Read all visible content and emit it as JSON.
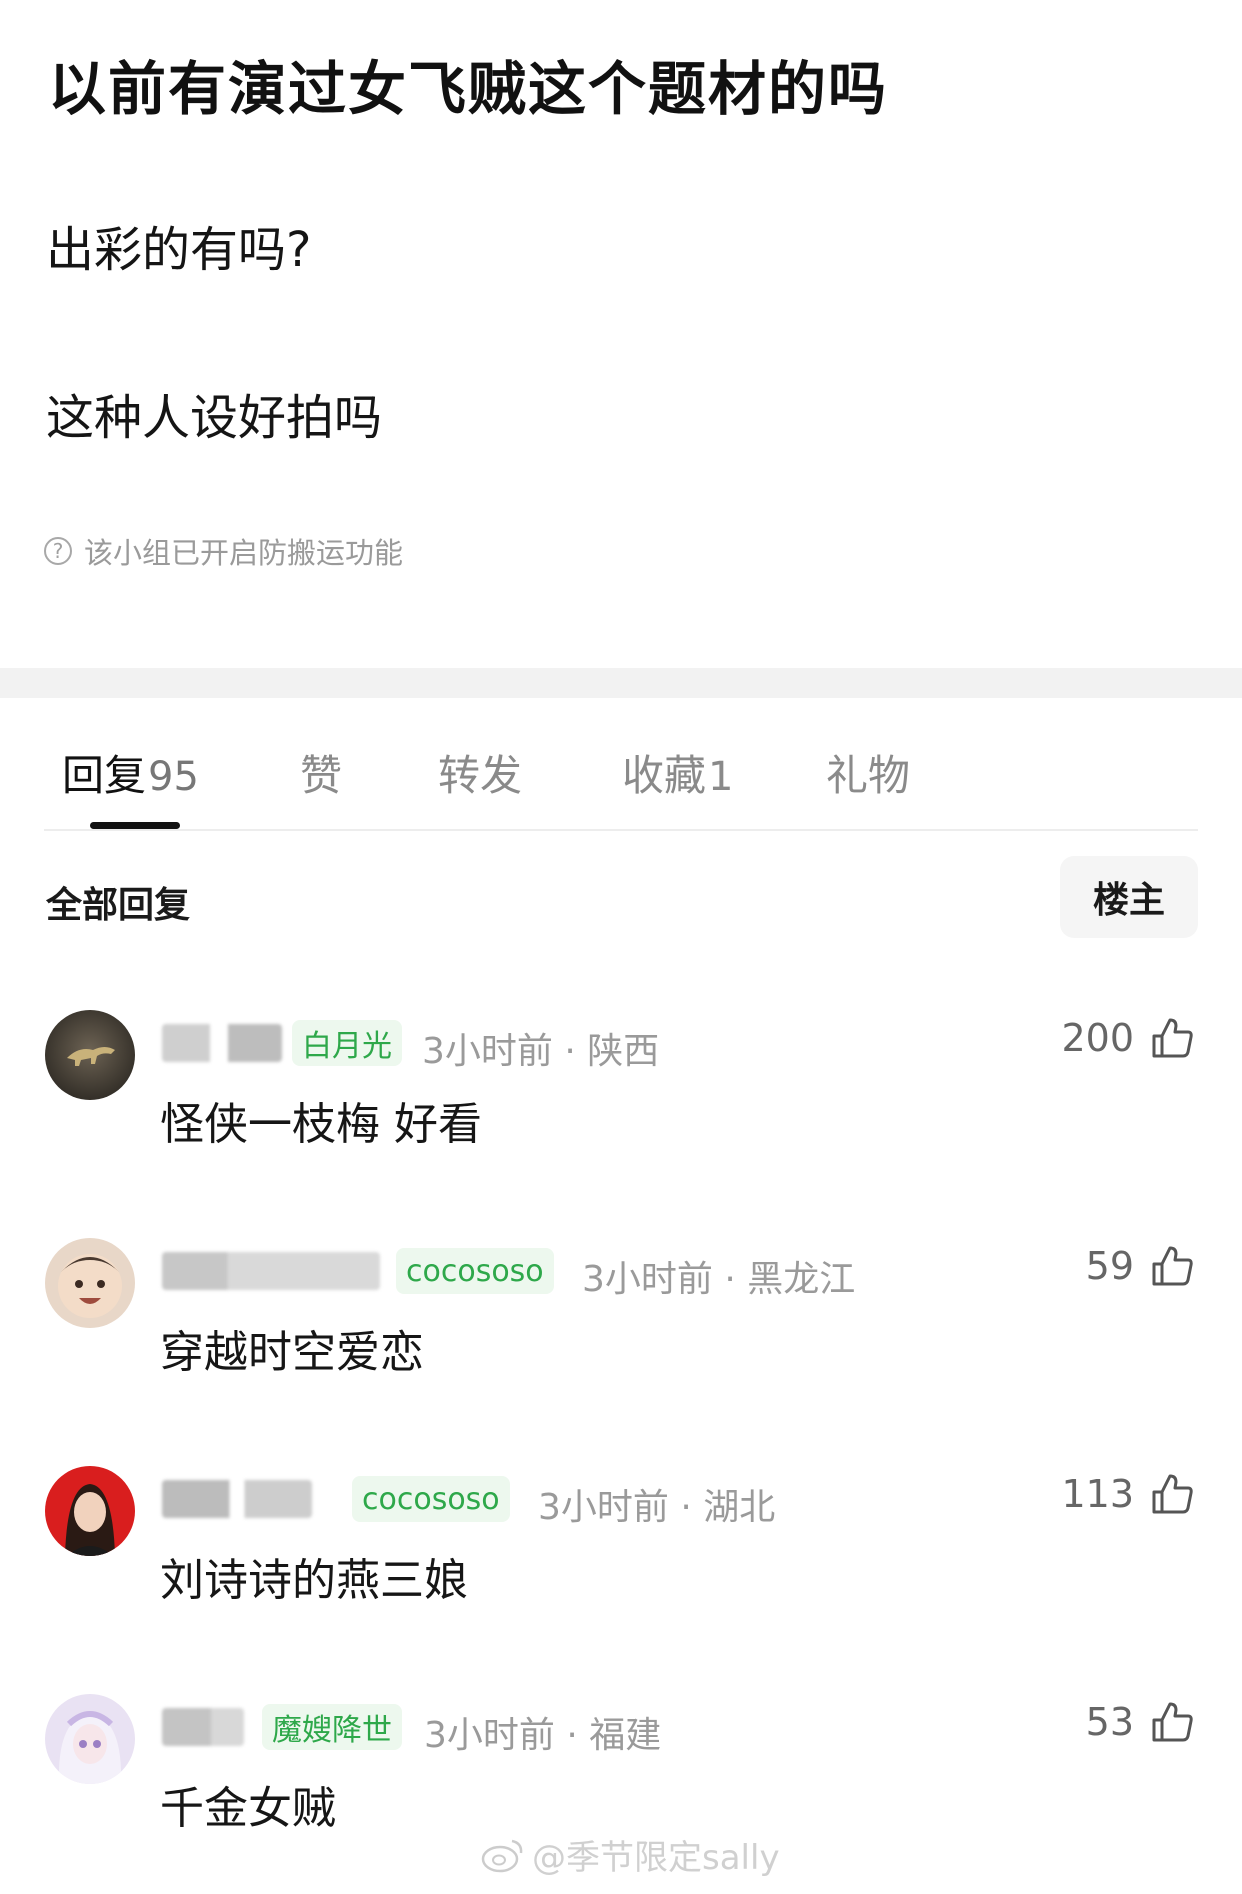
{
  "post": {
    "title": "以前有演过女飞贼这个题材的吗",
    "lines": [
      "出彩的有吗?",
      "这种人设好拍吗"
    ],
    "notice": "该小组已开启防搬运功能",
    "notice_icon": "question-circle-icon"
  },
  "tabs": [
    {
      "label": "回复",
      "count": "95",
      "active": true
    },
    {
      "label": "赞",
      "count": ""
    },
    {
      "label": "转发",
      "count": ""
    },
    {
      "label": "收藏",
      "count": "1"
    },
    {
      "label": "礼物",
      "count": ""
    }
  ],
  "filter": {
    "label": "全部回复",
    "owner_button": "楼主"
  },
  "comments": [
    {
      "badge": "白月光",
      "meta": "3小时前 · 陕西",
      "likes": "200",
      "text": "怪侠一枝梅 好看"
    },
    {
      "badge": "cocososo",
      "meta": "3小时前 · 黑龙江",
      "likes": "59",
      "text": "穿越时空爱恋"
    },
    {
      "badge": "cocososo",
      "meta": "3小时前 · 湖北",
      "likes": "113",
      "text": "刘诗诗的燕三娘"
    },
    {
      "badge": "魔嫂降世",
      "meta": "3小时前 · 福建",
      "likes": "53",
      "text": "千金女贼"
    }
  ],
  "watermark": "@季节限定sally",
  "colors": {
    "badge_bg": "#edf8ee",
    "badge_text": "#2ea84a",
    "meta_gray": "#9a9a9a",
    "divider": "#f2f2f2"
  }
}
